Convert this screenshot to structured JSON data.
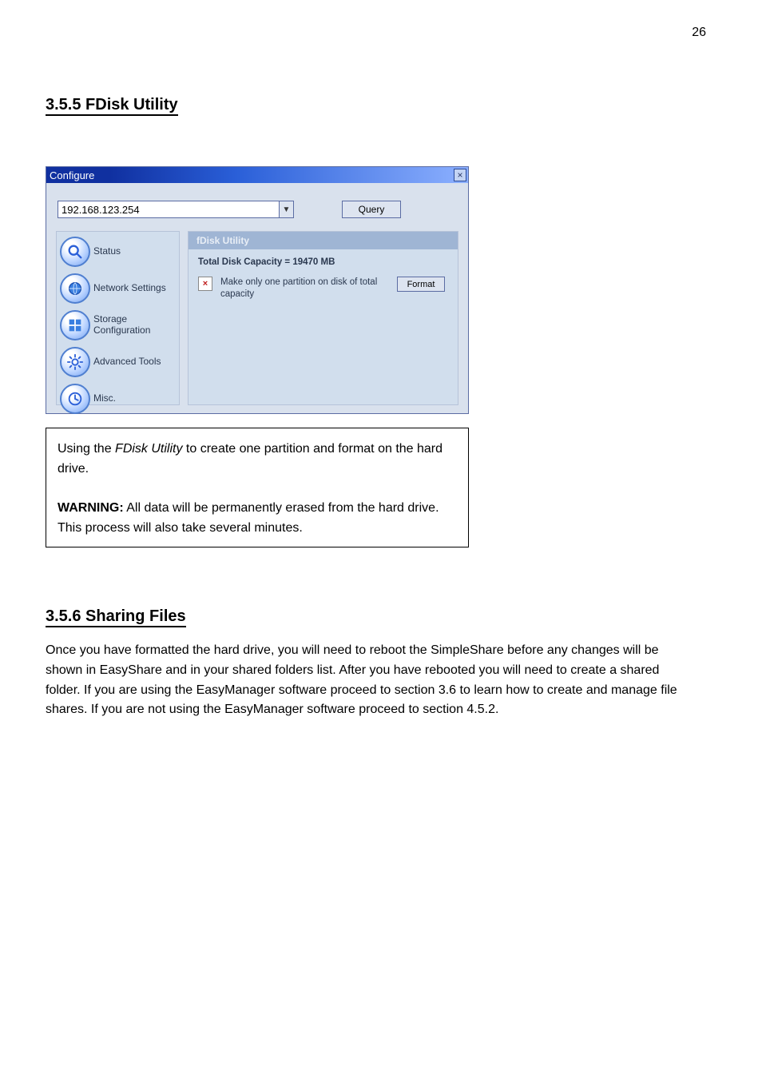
{
  "page_number": "26",
  "section1": {
    "title": "3.5.5 FDisk Utility"
  },
  "section2": {
    "title": "3.5.6 Sharing Files",
    "paragraph": "Once you have formatted the hard drive, you will need to reboot the SimpleShare before any changes will be shown in EasyShare and in your shared folders list. After you have rebooted you will need to create a shared folder. If you are using the EasyManager software proceed to section 3.6 to learn how to create and manage file shares. If you are not using the EasyManager software proceed to section 4.5.2."
  },
  "configure_window": {
    "title": "Configure",
    "ip_value": "192.168.123.254",
    "query_btn": "Query",
    "sidebar": [
      {
        "label": "Status",
        "icon": "magnifier"
      },
      {
        "label": "Network Settings",
        "icon": "globe"
      },
      {
        "label": "Storage Configuration",
        "icon": "grid"
      },
      {
        "label": "Advanced Tools",
        "icon": "gear"
      },
      {
        "label": "Misc.",
        "icon": "clock"
      }
    ],
    "panel": {
      "header": "fDisk Utility",
      "capacity_label": "Total Disk Capacity = 19470 MB",
      "partition_text": "Make only one partition on disk of total capacity",
      "format_btn": "Format"
    }
  },
  "info_box": {
    "line1_prefix": "Using the ",
    "line1_em": "FDisk Utility",
    "line1_suffix": " to create one partition and format on the hard drive.",
    "warning_prefix": "WARNING:",
    "warning_text": " All data will be permanently erased from the hard drive. This process will also take several minutes."
  }
}
